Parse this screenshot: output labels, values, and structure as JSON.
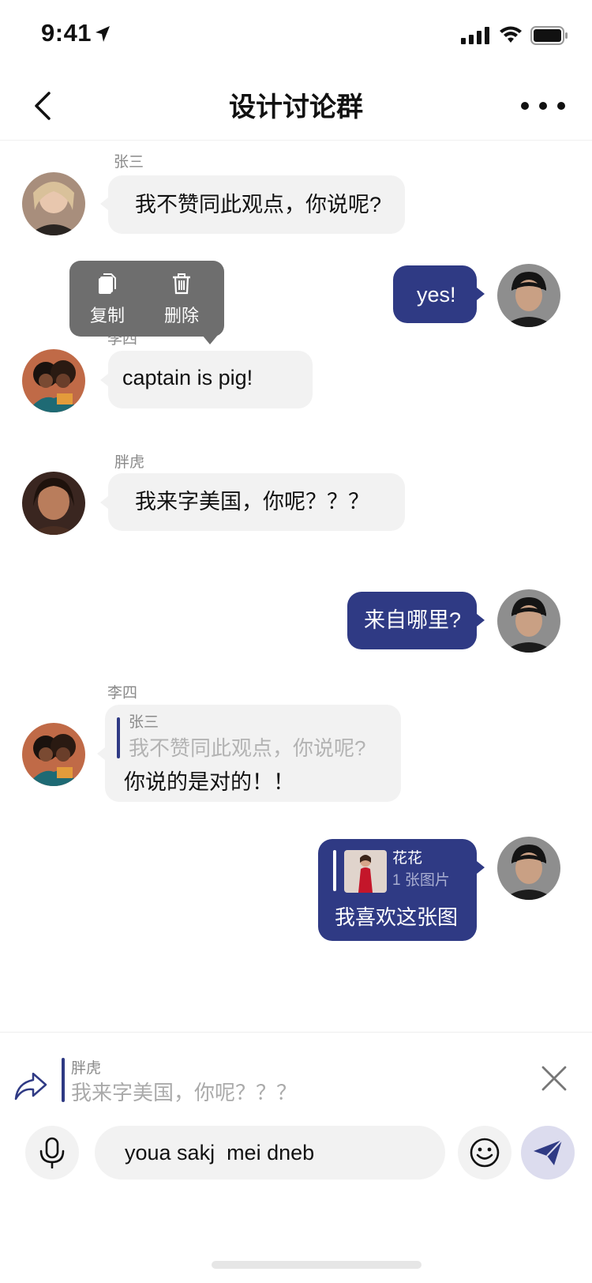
{
  "status_bar": {
    "time": "9:41"
  },
  "header": {
    "title": "设计讨论群"
  },
  "colors": {
    "accent": "#2f3a84",
    "bubble_in": "#f2f2f2",
    "menu_bg": "#6e6e6e"
  },
  "context_menu": {
    "items": [
      {
        "label": "复制",
        "icon": "copy-icon"
      },
      {
        "label": "删除",
        "icon": "trash-icon"
      }
    ]
  },
  "messages": [
    {
      "sender": "张三",
      "text": "我不赞同此观点，你说呢?",
      "direction": "in"
    },
    {
      "text": "yes!",
      "direction": "out"
    },
    {
      "sender": "李四",
      "text": "captain is pig!",
      "direction": "in"
    },
    {
      "sender": "胖虎",
      "text": "我来字美国，你呢？？？",
      "direction": "in"
    },
    {
      "text": "来自哪里?",
      "direction": "out"
    },
    {
      "sender": "李四",
      "quote": {
        "name": "张三",
        "text": "我不赞同此观点，你说呢?"
      },
      "text": "你说的是对的！！",
      "direction": "in"
    },
    {
      "quote": {
        "name": "花花",
        "text": "1 张图片"
      },
      "text": "我喜欢这张图",
      "direction": "out"
    }
  ],
  "composer": {
    "reply_to": {
      "name": "胖虎",
      "text": "我来字美国，你呢？？？"
    },
    "input_value": "youa sakj  mei dneb"
  }
}
